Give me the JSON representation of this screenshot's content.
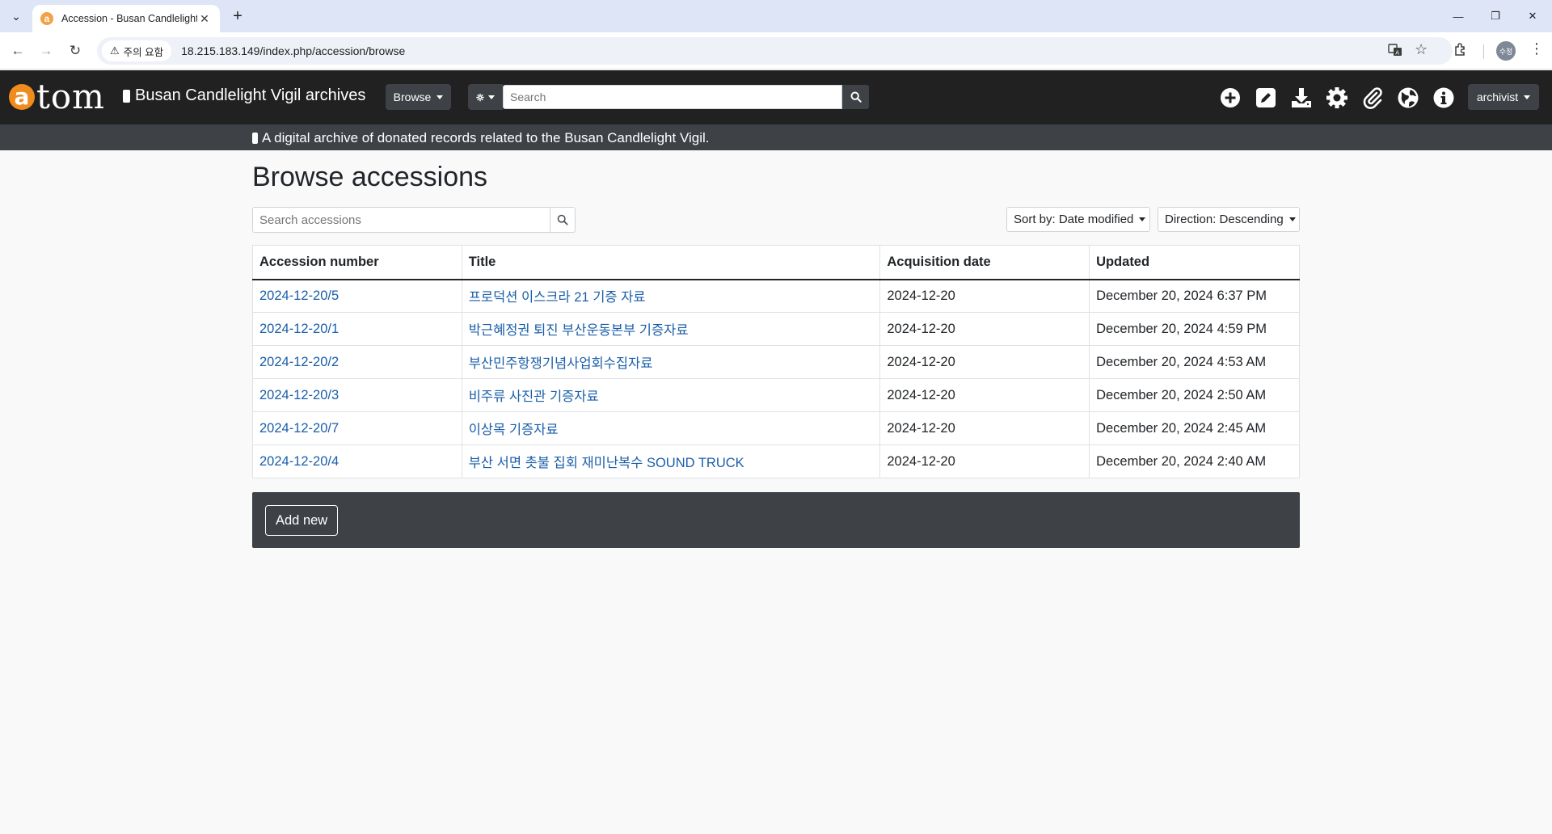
{
  "browser": {
    "tab_title": "Accession - Busan Candlelight Vigil archives",
    "security_chip": "주의 요함",
    "url": "18.215.183.149/index.php/accession/browse",
    "profile_initials": "수정"
  },
  "header": {
    "logo_letter": "a",
    "logo_rest": "tom",
    "site_name": "Busan Candlelight Vigil archives",
    "browse_label": "Browse",
    "search_placeholder": "Search",
    "user_label": "archivist",
    "tagline": "A digital archive of donated records related to the Busan Candlelight Vigil."
  },
  "main": {
    "page_title": "Browse accessions",
    "search_placeholder": "Search accessions",
    "sort_label": "Sort by: Date modified",
    "direction_label": "Direction: Descending",
    "columns": [
      "Accession number",
      "Title",
      "Acquisition date",
      "Updated"
    ],
    "rows": [
      {
        "number": "2024-12-20/5",
        "title": "프로덕션 이스크라 21 기증 자료",
        "acquired": "2024-12-20",
        "updated": "December 20, 2024 6:37 PM"
      },
      {
        "number": "2024-12-20/1",
        "title": "박근혜정권 퇴진 부산운동본부 기증자료",
        "acquired": "2024-12-20",
        "updated": "December 20, 2024 4:59 PM"
      },
      {
        "number": "2024-12-20/2",
        "title": "부산민주항쟁기념사업회수집자료",
        "acquired": "2024-12-20",
        "updated": "December 20, 2024 4:53 AM"
      },
      {
        "number": "2024-12-20/3",
        "title": "비주류 사진관 기증자료",
        "acquired": "2024-12-20",
        "updated": "December 20, 2024 2:50 AM"
      },
      {
        "number": "2024-12-20/7",
        "title": "이상목 기증자료",
        "acquired": "2024-12-20",
        "updated": "December 20, 2024 2:45 AM"
      },
      {
        "number": "2024-12-20/4",
        "title": "부산 서면 촛불 집회 재미난복수 SOUND TRUCK",
        "acquired": "2024-12-20",
        "updated": "December 20, 2024 2:40 AM"
      }
    ],
    "add_new_label": "Add new"
  },
  "colors": {
    "header_bg": "#212121",
    "bar_bg": "#3e4247",
    "logo_orange": "#f08b1d",
    "link": "#1a5ea8"
  },
  "icons": [
    "chevron-down-icon",
    "close-icon",
    "plus-icon",
    "back-arrow-icon",
    "forward-arrow-icon",
    "reload-icon",
    "warning-icon",
    "translate-icon",
    "star-icon",
    "extensions-icon",
    "kebab-menu-icon",
    "gear-icon",
    "search-icon",
    "add-circle-icon",
    "edit-icon",
    "import-icon",
    "settings-icon",
    "clip-icon",
    "globe-icon",
    "info-icon"
  ]
}
